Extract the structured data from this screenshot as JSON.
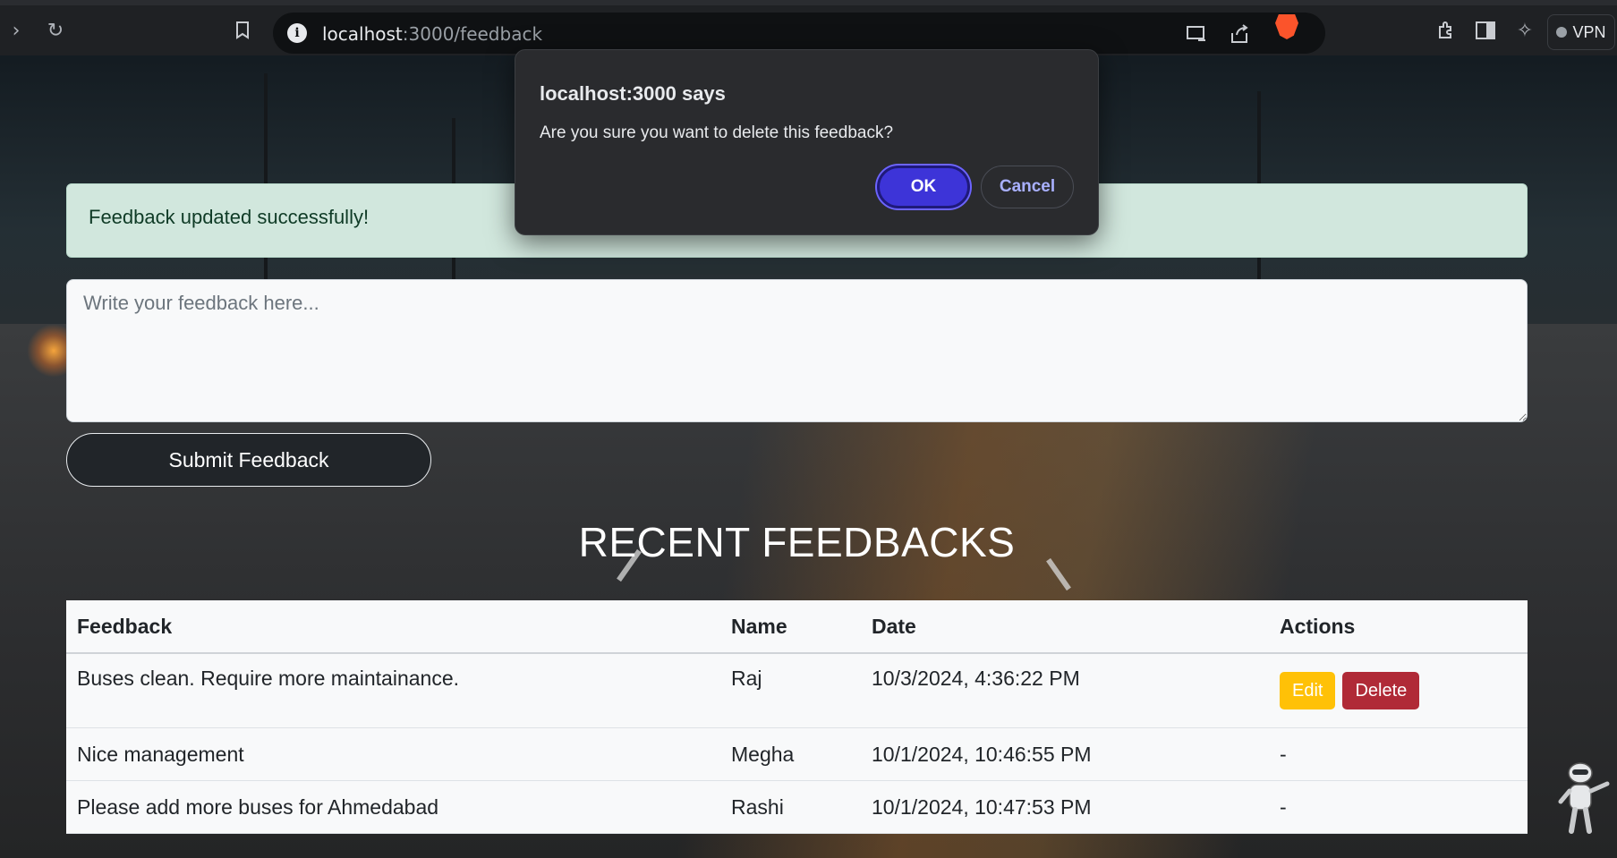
{
  "browser": {
    "url_host": "localhost",
    "url_path": ":3000/feedback",
    "vpn_label": "VPN",
    "icons": [
      "chevron-right-icon",
      "reload-icon",
      "bookmark-icon",
      "info-icon",
      "cast-icon",
      "share-icon",
      "brave-shield-icon",
      "extensions-icon",
      "sidebar-icon",
      "leo-ai-icon"
    ]
  },
  "dialog": {
    "title": "localhost:3000 says",
    "message": "Are you sure you want to delete this feedback?",
    "ok_label": "OK",
    "cancel_label": "Cancel"
  },
  "alert": {
    "message": "Feedback updated successfully!"
  },
  "form": {
    "placeholder": "Write your feedback here...",
    "submit_label": "Submit Feedback"
  },
  "section": {
    "title": "RECENT FEEDBACKS"
  },
  "table": {
    "headers": {
      "feedback": "Feedback",
      "name": "Name",
      "date": "Date",
      "actions": "Actions"
    },
    "rows": [
      {
        "feedback": "Buses clean. Require more maintainance.",
        "name": "Raj",
        "date": "10/3/2024, 4:36:22 PM",
        "edit_label": "Edit",
        "delete_label": "Delete"
      },
      {
        "feedback": "Nice management",
        "name": "Megha",
        "date": "10/1/2024, 10:46:55 PM",
        "actions": "-"
      },
      {
        "feedback": "Please add more buses for Ahmedabad",
        "name": "Rashi",
        "date": "10/1/2024, 10:47:53 PM",
        "actions": "-"
      }
    ]
  },
  "colors": {
    "alert_bg": "#d1e7dd",
    "ok_button": "#3d34d8",
    "edit_button": "#ffc107",
    "delete_button": "#b02a37",
    "submit_button": "#212529"
  }
}
